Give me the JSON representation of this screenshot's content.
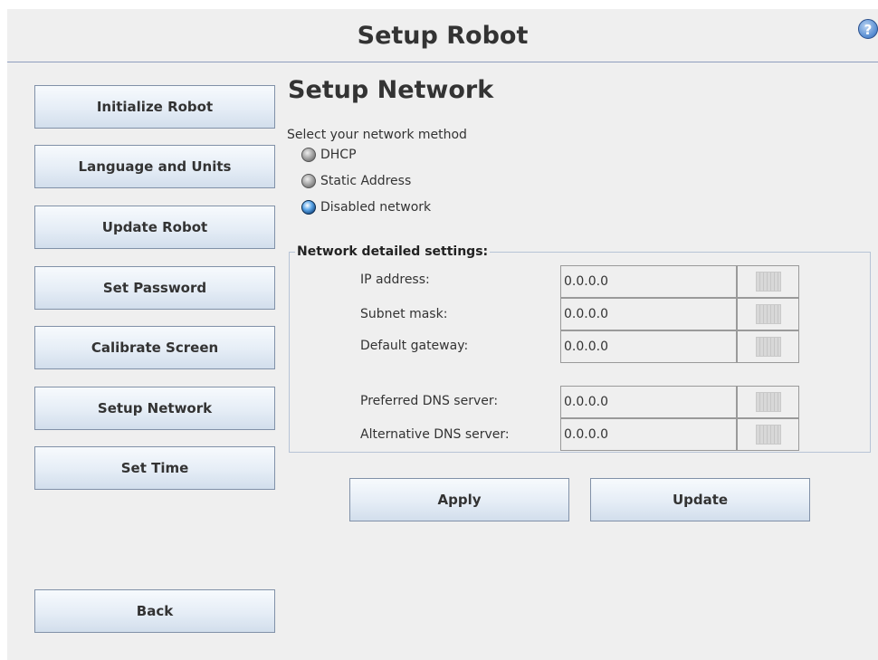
{
  "header": {
    "title": "Setup Robot",
    "help_icon": "?"
  },
  "sidebar": {
    "items": [
      {
        "label": "Initialize Robot"
      },
      {
        "label": "Language and Units"
      },
      {
        "label": "Update Robot"
      },
      {
        "label": "Set Password"
      },
      {
        "label": "Calibrate Screen"
      },
      {
        "label": "Setup Network"
      },
      {
        "label": "Set Time"
      }
    ],
    "back_label": "Back"
  },
  "main": {
    "title": "Setup Network",
    "method_prompt": "Select your network method",
    "methods": [
      {
        "label": "DHCP",
        "selected": false
      },
      {
        "label": "Static Address",
        "selected": false
      },
      {
        "label": "Disabled network",
        "selected": true
      }
    ],
    "settings": {
      "legend": "Network detailed settings:",
      "fields": [
        {
          "label": "IP address:",
          "value": "0.0.0.0"
        },
        {
          "label": "Subnet mask:",
          "value": "0.0.0.0"
        },
        {
          "label": "Default gateway:",
          "value": "0.0.0.0"
        },
        {
          "label": "Preferred DNS server:",
          "value": "0.0.0.0"
        },
        {
          "label": "Alternative DNS server:",
          "value": "0.0.0.0"
        }
      ]
    },
    "buttons": {
      "apply": "Apply",
      "update": "Update"
    }
  },
  "colors": {
    "background": "#efefef",
    "button_gradient_top": "#f7fafd",
    "button_gradient_bottom": "#d2deec",
    "button_border": "#8191a8",
    "selected_radio": "#174c87",
    "help_icon": "#5a8fd3"
  },
  "icons": {
    "help": "question-circle-icon",
    "radio_unselected": "radio-off-icon",
    "radio_selected": "radio-on-icon",
    "keyboard": "keyboard-icon"
  }
}
